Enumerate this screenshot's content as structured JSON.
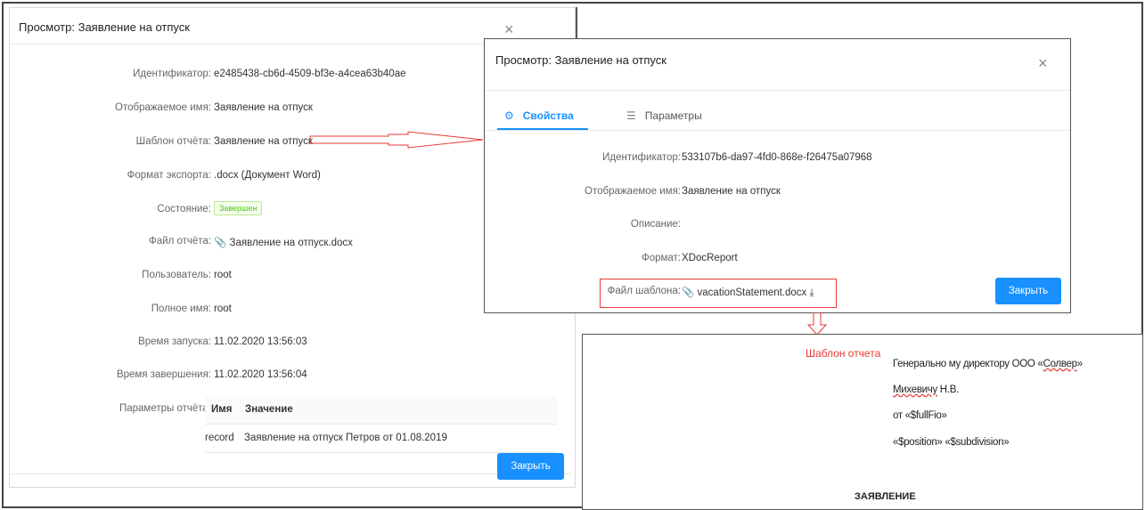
{
  "left_dialog": {
    "title": "Просмотр: Заявление на отпуск",
    "close_glyph": "×",
    "fields": [
      {
        "label": "Идентификатор:",
        "value": "e2485438-cb6d-4509-bf3e-a4cea63b40ae"
      },
      {
        "label": "Отображаемое имя:",
        "value": "Заявление на отпуск"
      },
      {
        "label": "Шаблон отчёта:",
        "value": "Заявление на отпуск"
      },
      {
        "label": "Формат экспорта:",
        "value": ".docx (Документ Word)"
      },
      {
        "label": "Состояние:",
        "value": "Завершен"
      },
      {
        "label": "Файл отчёта:",
        "value": "Заявление на отпуск.docx"
      },
      {
        "label": "Пользователь:",
        "value": "root"
      },
      {
        "label": "Полное имя:",
        "value": "root"
      },
      {
        "label": "Время запуска:",
        "value": "11.02.2020 13:56:03"
      },
      {
        "label": "Время завершения:",
        "value": "11.02.2020 13:56:04"
      }
    ],
    "params_label": "Параметры отчёта:",
    "params_table": {
      "headers": [
        "Имя",
        "Значение"
      ],
      "rows": [
        [
          "record",
          "Заявление на отпуск Петров от 01.08.2019"
        ]
      ]
    },
    "close_button": "Закрыть"
  },
  "right_dialog": {
    "title": "Просмотр: Заявление на отпуск",
    "close_glyph": "×",
    "tabs": [
      {
        "label": "Свойства",
        "icon": "gear-icon",
        "active": true
      },
      {
        "label": "Параметры",
        "icon": "list-icon",
        "active": false
      }
    ],
    "fields": [
      {
        "label": "Идентификатор:",
        "value": "533107b6-da97-4fd0-868e-f26475a07968"
      },
      {
        "label": "Отображаемое имя:",
        "value": "Заявление на отпуск"
      },
      {
        "label": "Описание:",
        "value": ""
      },
      {
        "label": "Формат:",
        "value": "XDocReport"
      },
      {
        "label": "Файл шаблона:",
        "value": "vacationStatement.docx"
      }
    ],
    "close_button": "Закрыть"
  },
  "document_preview": {
    "note": "Шаблон отчета",
    "lines": [
      {
        "prefix": "Генерально му директору ООО «",
        "marked": "Солвер",
        "suffix": "»"
      },
      {
        "prefix": "",
        "marked": "Михевичу",
        "suffix": " Н.В."
      },
      {
        "prefix": "от «$fullFio»",
        "marked": "",
        "suffix": ""
      },
      {
        "prefix": "«$position» «$subdivision»",
        "marked": "",
        "suffix": ""
      }
    ],
    "heading": "ЗАЯВЛЕНИЕ"
  },
  "colors": {
    "accent": "#1890ff",
    "annotation": "#e53935",
    "success": "#52c41a"
  }
}
